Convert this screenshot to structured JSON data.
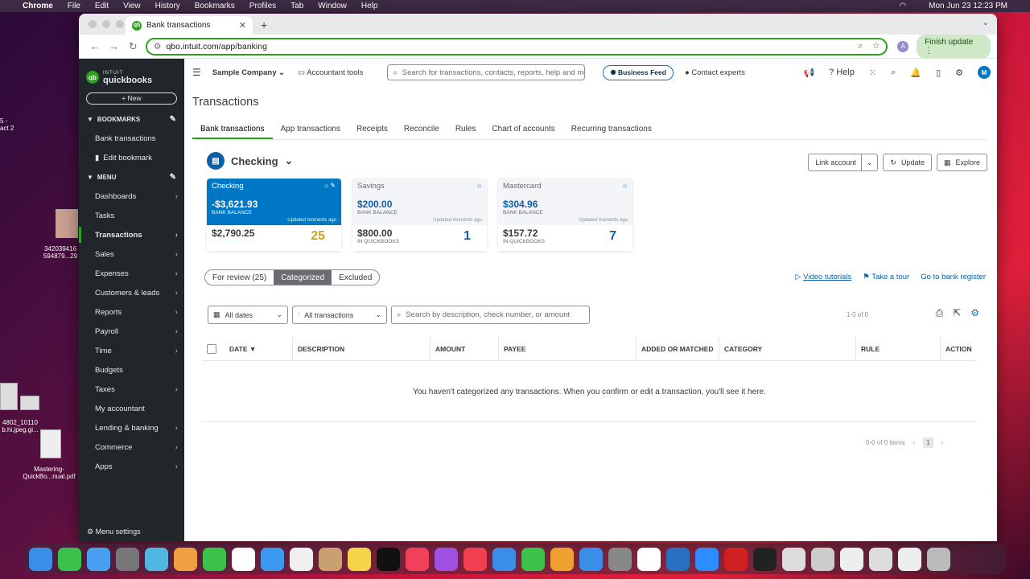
{
  "menubar": {
    "app": "Chrome",
    "items": [
      "File",
      "Edit",
      "View",
      "History",
      "Bookmarks",
      "Profiles",
      "Tab",
      "Window",
      "Help"
    ],
    "clock": "Mon Jun 23  12:23 PM"
  },
  "desktop": {
    "labels": [
      "5 -\nact 2",
      "342039416\n594879...29",
      "4802_10110\nb.hi.jpeg.gi...",
      "Mastering-\nQuickBo...nual.pdf"
    ]
  },
  "browser": {
    "tab_title": "Bank transactions",
    "url": "qbo.intuit.com/app/banking",
    "account_initial": "A",
    "finish_update": "Finish update"
  },
  "sidebar": {
    "logo_top": "INTUIT",
    "logo_name": "quickbooks",
    "new_label": "New",
    "bookmarks_label": "BOOKMARKS",
    "bookmarks": [
      "Bank transactions",
      "Edit bookmark"
    ],
    "menu_label": "MENU",
    "menu": [
      {
        "label": "Dashboards",
        "arrow": true
      },
      {
        "label": "Tasks",
        "arrow": false
      },
      {
        "label": "Transactions",
        "arrow": true,
        "active": true
      },
      {
        "label": "Sales",
        "arrow": true
      },
      {
        "label": "Expenses",
        "arrow": true
      },
      {
        "label": "Customers & leads",
        "arrow": true
      },
      {
        "label": "Reports",
        "arrow": true
      },
      {
        "label": "Payroll",
        "arrow": true
      },
      {
        "label": "Time",
        "arrow": true
      },
      {
        "label": "Budgets",
        "arrow": false
      },
      {
        "label": "Taxes",
        "arrow": true
      },
      {
        "label": "My accountant",
        "arrow": false
      },
      {
        "label": "Lending & banking",
        "arrow": true
      },
      {
        "label": "Commerce",
        "arrow": true
      },
      {
        "label": "Apps",
        "arrow": true
      }
    ],
    "menu_settings": "Menu settings"
  },
  "topnav": {
    "company": "Sample Company",
    "accountant_tools": "Accountant tools",
    "search_placeholder": "Search for transactions, contacts, reports, help and more",
    "business_feed": "Business Feed",
    "contact_experts": "Contact experts",
    "help": "Help",
    "avatar": "M"
  },
  "page": {
    "title": "Transactions",
    "tabs": [
      "Bank transactions",
      "App transactions",
      "Receipts",
      "Reconcile",
      "Rules",
      "Chart of accounts",
      "Recurring transactions"
    ],
    "account_selected": "Checking",
    "buttons": {
      "link_account": "Link account",
      "update": "Update",
      "explore": "Explore"
    }
  },
  "cards": [
    {
      "name": "Checking",
      "bank_balance": "-$3,621.93",
      "bank_label": "BANK BALANCE",
      "updated": "Updated moments ago",
      "qb_balance": "$2,790.25",
      "qb_label": "IN QUICKBOOKS",
      "count": "25"
    },
    {
      "name": "Savings",
      "bank_balance": "$200.00",
      "bank_label": "BANK BALANCE",
      "updated": "Updated moments ago",
      "qb_balance": "$800.00",
      "qb_label": "IN QUICKBOOKS",
      "count": "1"
    },
    {
      "name": "Mastercard",
      "bank_balance": "$304.96",
      "bank_label": "BANK BALANCE",
      "updated": "Updated moments ago",
      "qb_balance": "$157.72",
      "qb_label": "IN QUICKBOOKS",
      "count": "7"
    }
  ],
  "segments": {
    "review": "For review (25)",
    "categorized": "Categorized",
    "excluded": "Excluded"
  },
  "links": {
    "video": "Video tutorials",
    "tour": "Take a tour",
    "register": "Go to bank register"
  },
  "filters": {
    "dates": "All dates",
    "transactions": "All transactions",
    "search_placeholder": "Search by description, check number, or amount",
    "range": "1-0 of 0"
  },
  "table": {
    "headers": [
      "DATE",
      "DESCRIPTION",
      "AMOUNT",
      "PAYEE",
      "ADDED OR MATCHED",
      "CATEGORY",
      "RULE",
      "ACTION"
    ],
    "empty": "You haven't categorized any transactions. When you confirm or edit a transaction, you'll see it here.",
    "items": "0-0 of 0 items",
    "page": "1"
  }
}
